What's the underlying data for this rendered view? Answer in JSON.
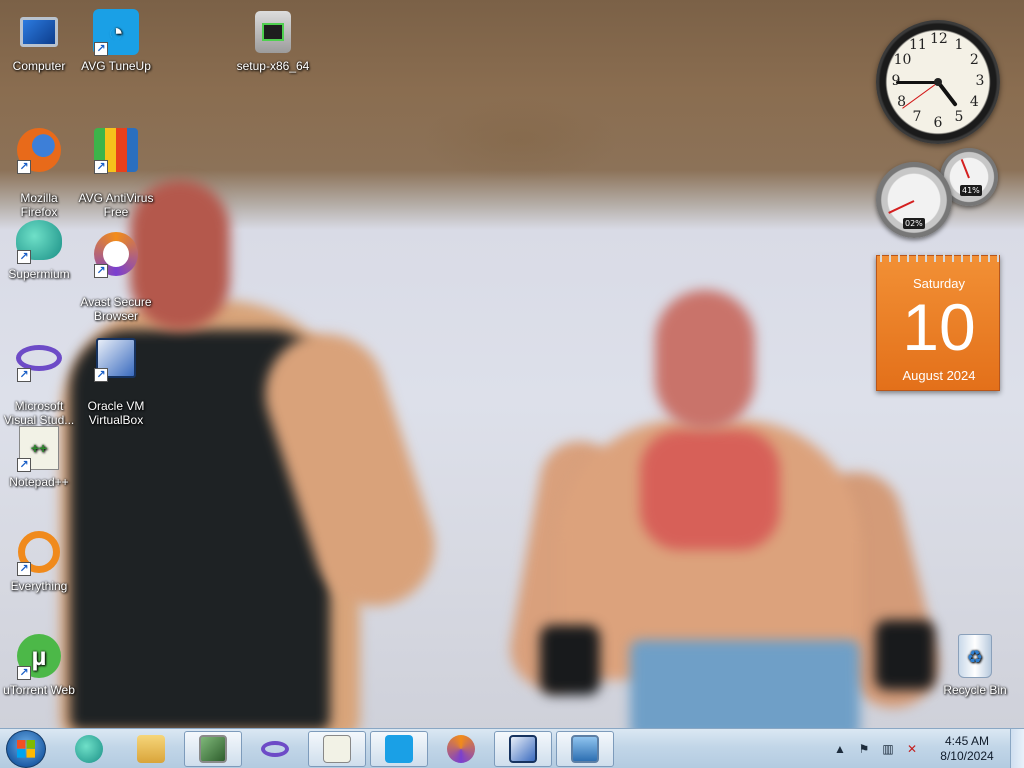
{
  "desktop": {
    "icons": [
      {
        "label": "Computer",
        "icon": "computer-icon"
      },
      {
        "label": "AVG TuneUp",
        "icon": "tuneup-icon"
      },
      {
        "label": "setup-x86_64",
        "icon": "setup-icon"
      },
      {
        "label": "Mozilla\nFirefox",
        "icon": "firefox-icon"
      },
      {
        "label": "AVG AntiVirus\nFree",
        "icon": "avg-antivirus-icon"
      },
      {
        "label": "Supermium",
        "icon": "supermium-icon"
      },
      {
        "label": "Avast Secure\nBrowser",
        "icon": "avast-icon"
      },
      {
        "label": "Microsoft\nVisual Stud...",
        "icon": "visual-studio-icon"
      },
      {
        "label": "Oracle VM\nVirtualBox",
        "icon": "virtualbox-icon"
      },
      {
        "label": "Notepad++",
        "icon": "notepadpp-icon"
      },
      {
        "label": "Everything",
        "icon": "everything-icon"
      },
      {
        "label": "uTorrent Web",
        "icon": "utorrent-icon"
      },
      {
        "label": "Recycle Bin",
        "icon": "recycle-bin-icon"
      }
    ]
  },
  "gadgets": {
    "clock": {
      "numbers": [
        "12",
        "1",
        "2",
        "3",
        "4",
        "5",
        "6",
        "7",
        "8",
        "9",
        "10",
        "11"
      ],
      "hour": 4,
      "minute": 45,
      "second": 39
    },
    "cpu_meter": {
      "cpu": "02%",
      "memory": "41%",
      "cpu_fraction": 0.02,
      "memory_fraction": 0.41
    },
    "calendar": {
      "day_name": "Saturday",
      "day": "10",
      "month_year": "August 2024"
    }
  },
  "taskbar": {
    "pinned": [
      "supermium-icon",
      "explorer-icon",
      "task-manager-icon",
      "visual-studio-icon",
      "notepadpp-icon",
      "tuneup-icon",
      "avast-icon",
      "virtualbox-icon",
      "photo-viewer-icon"
    ],
    "tray": {
      "time": "4:45 AM",
      "date": "8/10/2024"
    }
  },
  "colors": {
    "calendar_orange": "#e97b22",
    "taskbar": "#c2d6e8"
  }
}
